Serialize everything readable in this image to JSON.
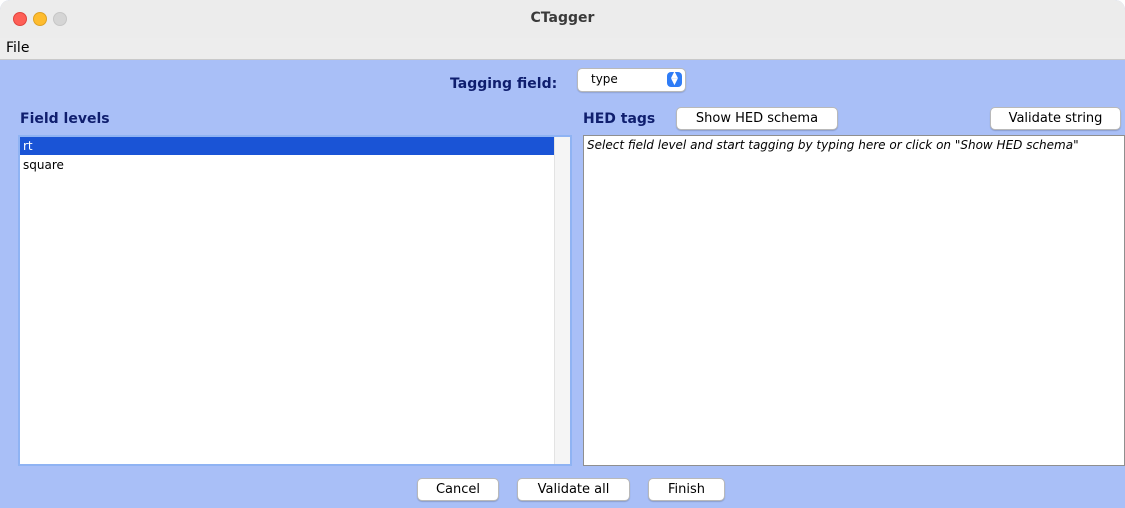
{
  "window": {
    "title": "CTagger"
  },
  "menu": {
    "file": "File"
  },
  "tagging": {
    "label": "Tagging field:",
    "selected": "type"
  },
  "field_levels": {
    "label": "Field levels",
    "items": [
      "rt",
      "square"
    ],
    "selected_index": 0
  },
  "hed": {
    "label": "HED tags",
    "show_schema_button": "Show HED schema",
    "validate_string_button": "Validate string",
    "placeholder": "Select field level and start tagging by typing here or click on \"Show HED schema\""
  },
  "footer": {
    "cancel": "Cancel",
    "validate_all": "Validate all",
    "finish": "Finish"
  },
  "colors": {
    "background": "#a9bff7",
    "selection": "#1a54d6",
    "label_text": "#0f1e6e"
  }
}
